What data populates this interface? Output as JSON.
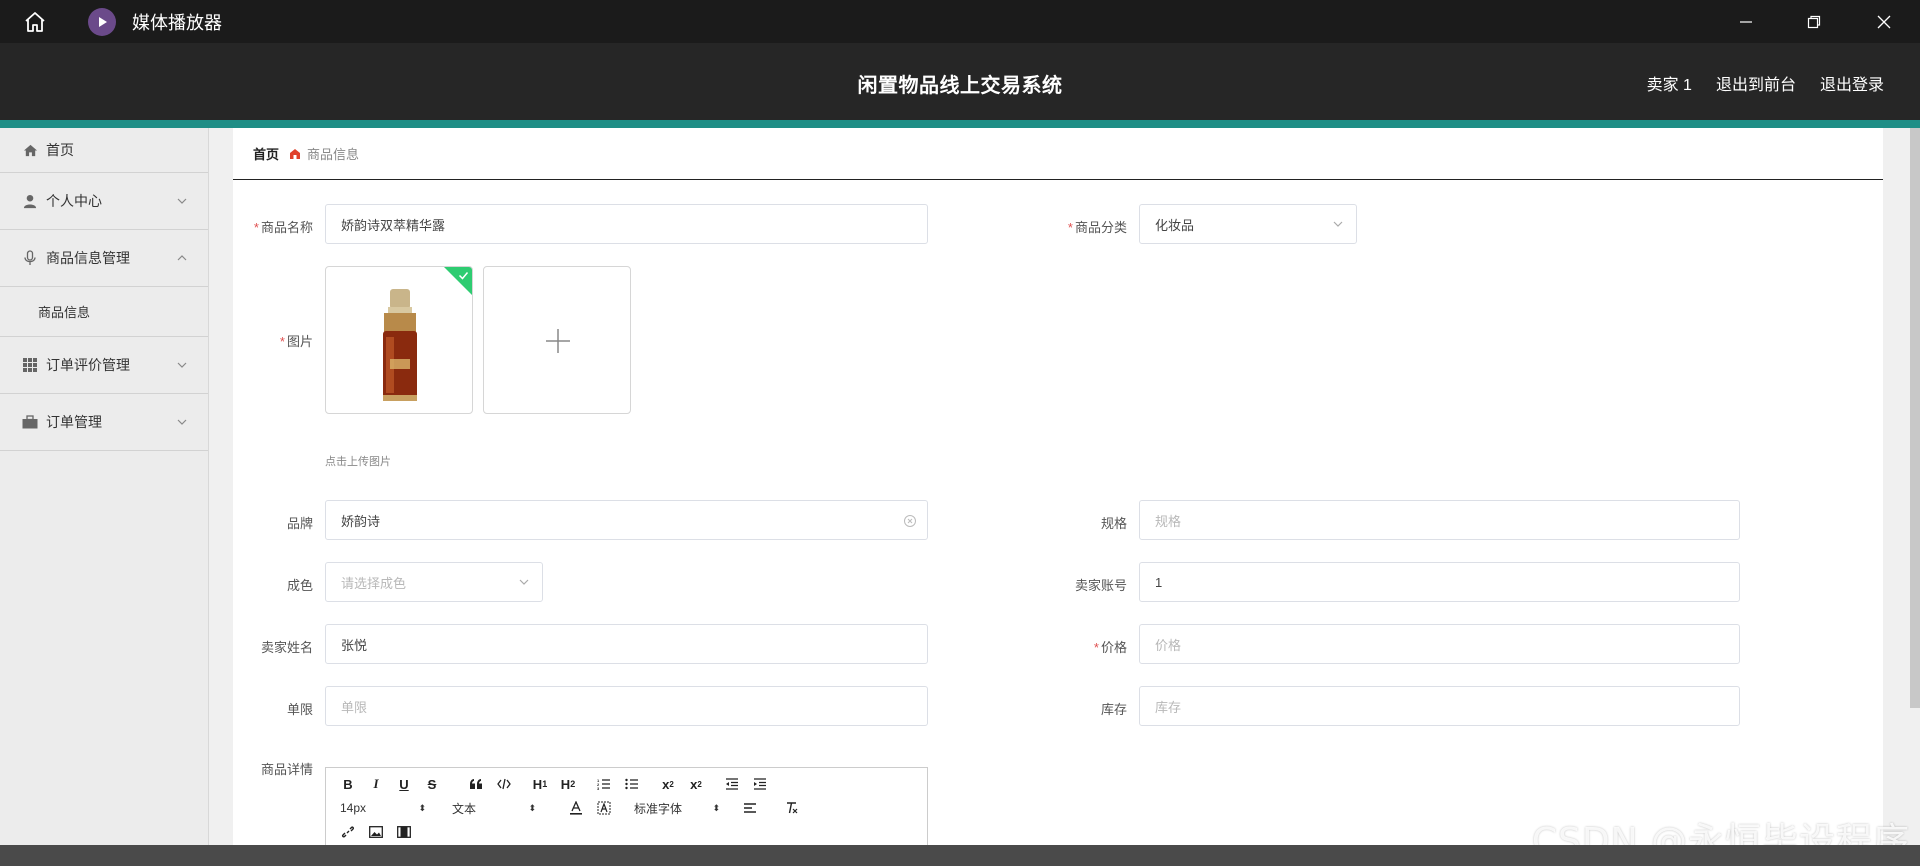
{
  "player": {
    "title": "媒体播放器"
  },
  "header": {
    "system_title": "闲置物品线上交易系统",
    "user": "卖家 1",
    "exit_front": "退出到前台",
    "logout": "退出登录"
  },
  "sidebar": {
    "items": [
      {
        "label": "首页",
        "icon": "home-icon"
      },
      {
        "label": "个人中心",
        "icon": "user-icon"
      },
      {
        "label": "商品信息管理",
        "icon": "mic-icon",
        "expanded": true,
        "children": [
          "商品信息"
        ]
      },
      {
        "label": "订单评价管理",
        "icon": "grid-icon"
      },
      {
        "label": "订单管理",
        "icon": "briefcase-icon"
      }
    ]
  },
  "breadcrumb": {
    "home": "首页",
    "current": "商品信息"
  },
  "form": {
    "name_label": "商品名称",
    "name_value": "娇韵诗双萃精华露",
    "category_label": "商品分类",
    "category_value": "化妆品",
    "image_label": "图片",
    "upload_hint": "点击上传图片",
    "brand_label": "品牌",
    "brand_value": "娇韵诗",
    "spec_label": "规格",
    "spec_placeholder": "规格",
    "condition_label": "成色",
    "condition_placeholder": "请选择成色",
    "seller_account_label": "卖家账号",
    "seller_account_value": "1",
    "seller_name_label": "卖家姓名",
    "seller_name_value": "张悦",
    "price_label": "价格",
    "price_placeholder": "价格",
    "limit_label": "单限",
    "limit_placeholder": "单限",
    "stock_label": "库存",
    "stock_placeholder": "库存",
    "detail_label": "商品详情"
  },
  "editor": {
    "font_size": "14px",
    "text_type": "文本",
    "font_family": "标准字体",
    "buttons_row1": [
      "B",
      "I",
      "U",
      "S",
      "quote",
      "code",
      "H1",
      "H2",
      "ol",
      "ul",
      "sub",
      "sup",
      "outdent",
      "indent"
    ],
    "buttons_row3": [
      "link",
      "image",
      "video"
    ]
  },
  "watermark": "CSDN @永恒毕设程序",
  "colors": {
    "accent": "#1f8e86",
    "required": "#e05050",
    "header": "#262626",
    "success": "#2ecc71"
  }
}
